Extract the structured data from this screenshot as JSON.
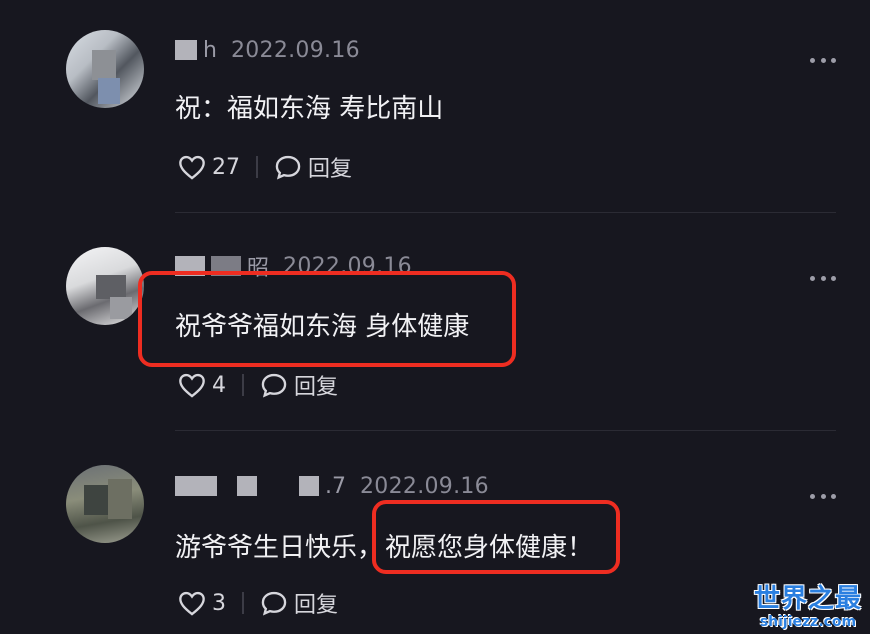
{
  "comments": [
    {
      "username": "h",
      "date": "2022.09.16",
      "text": "祝：福如东海 寿比南山",
      "likes": "27",
      "reply_label": "回复"
    },
    {
      "username": "昭",
      "date": "2022.09.16",
      "text": "祝爷爷福如东海 身体健康",
      "likes": "4",
      "reply_label": "回复"
    },
    {
      "username": ".7",
      "date": "2022.09.16",
      "text_part1": "游爷爷生日快乐，",
      "text_part2": "祝愿您身体健康！",
      "likes": "3",
      "reply_label": "回复"
    }
  ],
  "watermark": {
    "main": "世界之最",
    "sub": "shijiezz.com"
  },
  "colors": {
    "background": "#17171f",
    "highlight": "#ee2d21",
    "watermark": "#2a7fe0"
  },
  "icons": {
    "like": "heart-icon",
    "reply": "speech-bubble-icon",
    "more": "more-dots-icon"
  }
}
